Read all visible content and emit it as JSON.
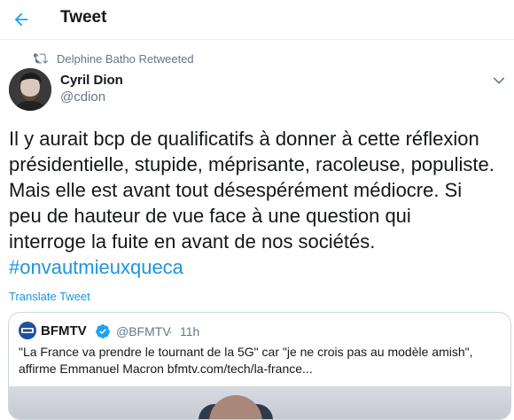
{
  "header": {
    "title": "Tweet",
    "back_icon": "arrow-left-icon",
    "accent": "#1da1f2"
  },
  "retweet": {
    "icon": "retweet-icon",
    "text": "Delphine Batho Retweeted"
  },
  "author": {
    "name": "Cyril Dion",
    "handle": "@cdion"
  },
  "tweet": {
    "lines": [
      "Il y aurait bcp de qualificatifs à donner à cette réflexion",
      "présidentielle, stupide, méprisante, racoleuse, populiste.",
      "Mais elle est avant tout désespérément médiocre. Si",
      "peu de hauteur de vue face à une question qui",
      "interroge la fuite en avant de nos sociétés."
    ],
    "hashtag": "#onvautmieuxqueca",
    "translate_label": "Translate Tweet"
  },
  "quote": {
    "name": "BFMTV",
    "handle": "@BFMTV",
    "separator": "·",
    "time": "11h",
    "text_lines": [
      "\"La France va prendre le tournant de la 5G\" car \"je ne crois pas au modèle amish\",",
      "affirme Emmanuel Macron bfmtv.com/tech/la-france..."
    ]
  },
  "colors": {
    "link": "#1b95e0",
    "muted": "#657786",
    "text": "#14171a",
    "border": "#e6ecf0"
  }
}
